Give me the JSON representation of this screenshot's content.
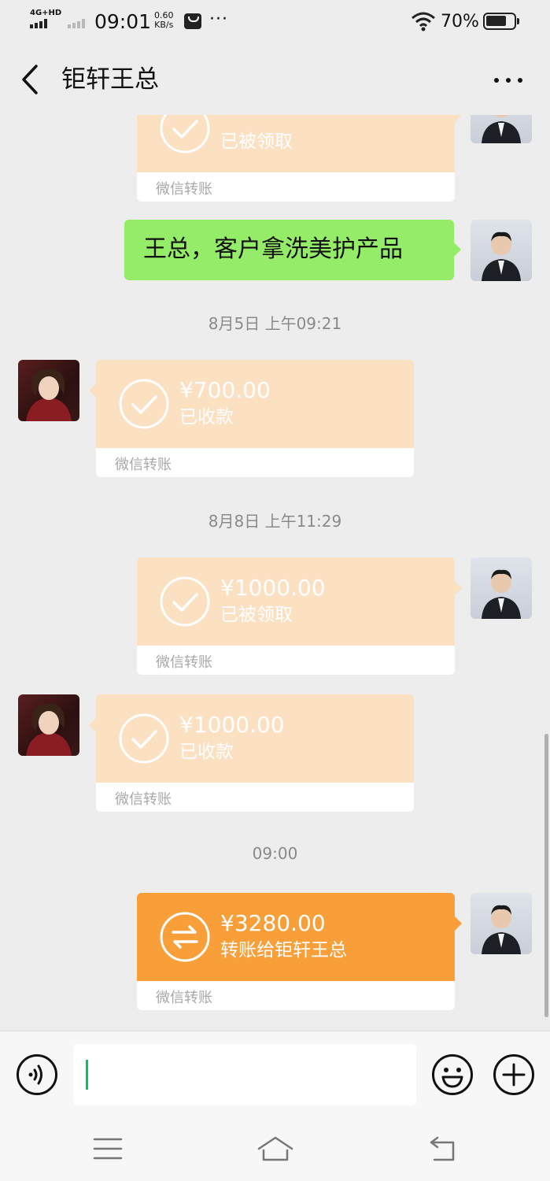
{
  "status_bar": {
    "network": "4G+HD",
    "time": "09:01",
    "speed_value": "0.60",
    "speed_unit": "KB/s",
    "more": "···",
    "battery": "70%"
  },
  "header": {
    "title": "钜轩王总"
  },
  "messages": {
    "m1": {
      "status": "已被领取",
      "label": "微信转账"
    },
    "m2": {
      "text": "王总，客户拿洗美护产品"
    },
    "ts1": "8月5日 上午09:21",
    "m3": {
      "amount": "¥700.00",
      "status": "已收款",
      "label": "微信转账"
    },
    "ts2": "8月8日 上午11:29",
    "m4": {
      "amount": "¥1000.00",
      "status": "已被领取",
      "label": "微信转账"
    },
    "m5": {
      "amount": "¥1000.00",
      "status": "已收款",
      "label": "微信转账"
    },
    "ts3": "09:00",
    "m6": {
      "amount": "¥3280.00",
      "status": "转账给钜轩王总",
      "label": "微信转账"
    }
  },
  "colors": {
    "transfer_received": "#fbe0c2",
    "transfer_pending": "#f89f3a",
    "text_bubble": "#95ec69",
    "caret": "#07c160"
  }
}
